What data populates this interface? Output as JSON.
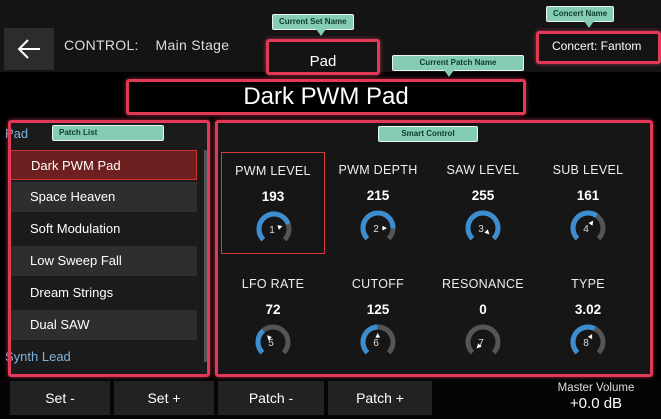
{
  "header": {
    "control_label": "CONTROL:",
    "scene_name": "Main Stage",
    "current_set": "Pad",
    "concert": "Concert: Fantom",
    "current_patch": "Dark PWM Pad"
  },
  "callouts": {
    "set_name": "Current Set Name",
    "concert_name": "Concert Name",
    "patch_name": "Current Patch Name",
    "patch_list": "Patch List",
    "smart_control": "Smart Control"
  },
  "patch_list": {
    "group_top": "Pad",
    "items": [
      "Dark PWM Pad",
      "Space Heaven",
      "Soft Modulation",
      "Low Sweep Fall",
      "Dream Strings",
      "Dual SAW"
    ],
    "group_bottom": "Synth Lead"
  },
  "knobs": [
    {
      "label": "PWM LEVEL",
      "value": "193",
      "num": "1",
      "level": 0.76
    },
    {
      "label": "PWM DEPTH",
      "value": "215",
      "num": "2",
      "level": 0.84
    },
    {
      "label": "SAW LEVEL",
      "value": "255",
      "num": "3",
      "level": 1.0
    },
    {
      "label": "SUB LEVEL",
      "value": "161",
      "num": "4",
      "level": 0.63
    },
    {
      "label": "LFO RATE",
      "value": "72",
      "num": "5",
      "level": 0.35
    },
    {
      "label": "CUTOFF",
      "value": "125",
      "num": "6",
      "level": 0.49
    },
    {
      "label": "RESONANCE",
      "value": "0",
      "num": "7",
      "level": 0.0
    },
    {
      "label": "TYPE",
      "value": "3.02",
      "num": "8",
      "level": 0.6
    }
  ],
  "footer": {
    "set_minus": "Set -",
    "set_plus": "Set +",
    "patch_minus": "Patch -",
    "patch_plus": "Patch +",
    "master_label": "Master Volume",
    "master_value": "+0.0 dB"
  },
  "colors": {
    "highlight": "#e23a56",
    "callout": "#84cdb4",
    "knob_arc": "#3d8ed0",
    "selected_row": "#6e1f1f",
    "group_text": "#7fb4de"
  },
  "icons": {
    "back": "back-arrow-icon"
  }
}
